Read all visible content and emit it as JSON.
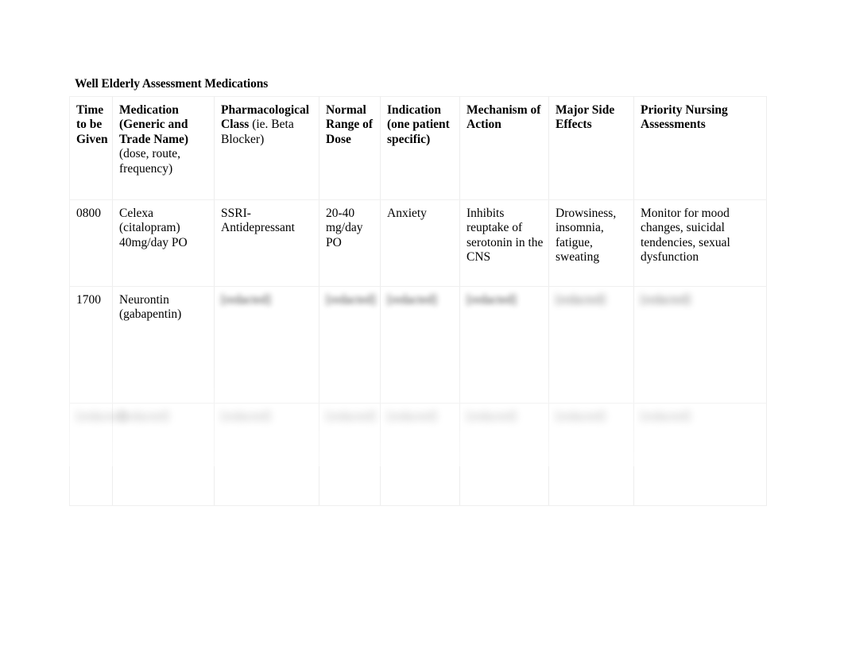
{
  "document": {
    "title": "Well Elderly Assessment Medications"
  },
  "table": {
    "headers": [
      {
        "bold": "Time to be Given",
        "normal": ""
      },
      {
        "bold": "Medication (Generic and Trade Name)",
        "normal": "(dose, route, frequency)"
      },
      {
        "bold": "Pharmacological Class ",
        "normal": "(ie. Beta Blocker)"
      },
      {
        "bold": "Normal Range of Dose",
        "normal": ""
      },
      {
        "bold": "Indication (one patient specific)",
        "normal": ""
      },
      {
        "bold": "Mechanism of Action",
        "normal": ""
      },
      {
        "bold": "Major Side Effects",
        "normal": ""
      },
      {
        "bold": "Priority Nursing Assessments",
        "normal": ""
      }
    ],
    "rows": [
      {
        "id": "row-celexa",
        "redaction": "none",
        "cells": [
          "0800",
          "Celexa (citalopram) 40mg/day PO",
          "SSRI-Antidepressant",
          "20-40 mg/day PO",
          "Anxiety",
          "Inhibits reuptake of serotonin in the CNS",
          "Drowsiness, insomnia, fatigue, sweating",
          "Monitor for mood changes, suicidal tendencies, sexual dysfunction"
        ]
      },
      {
        "id": "row-neurontin",
        "redaction": "partial",
        "cells": [
          "1700",
          "Neurontin (gabapentin)",
          "[redacted]",
          "[redacted]",
          "[redacted]",
          "[redacted]",
          "[redacted]",
          "[redacted]"
        ],
        "cell_blur": [
          "none",
          "none",
          "mid",
          "mid",
          "mid",
          "mid",
          "heavy",
          "heavy"
        ]
      },
      {
        "id": "row-three",
        "redaction": "full",
        "cells": [
          "[redacted]",
          "[redacted]",
          "[redacted]",
          "[redacted]",
          "[redacted]",
          "[redacted]",
          "[redacted]",
          "[redacted]"
        ],
        "cell_blur": [
          "xheavy",
          "xheavy",
          "xheavy",
          "xheavy",
          "xheavy",
          "xheavy",
          "xheavy",
          "xheavy"
        ]
      }
    ]
  },
  "appearance": {
    "page_background": "#ffffff",
    "text_color": "#000000",
    "border_color": "#f0f0f0"
  }
}
